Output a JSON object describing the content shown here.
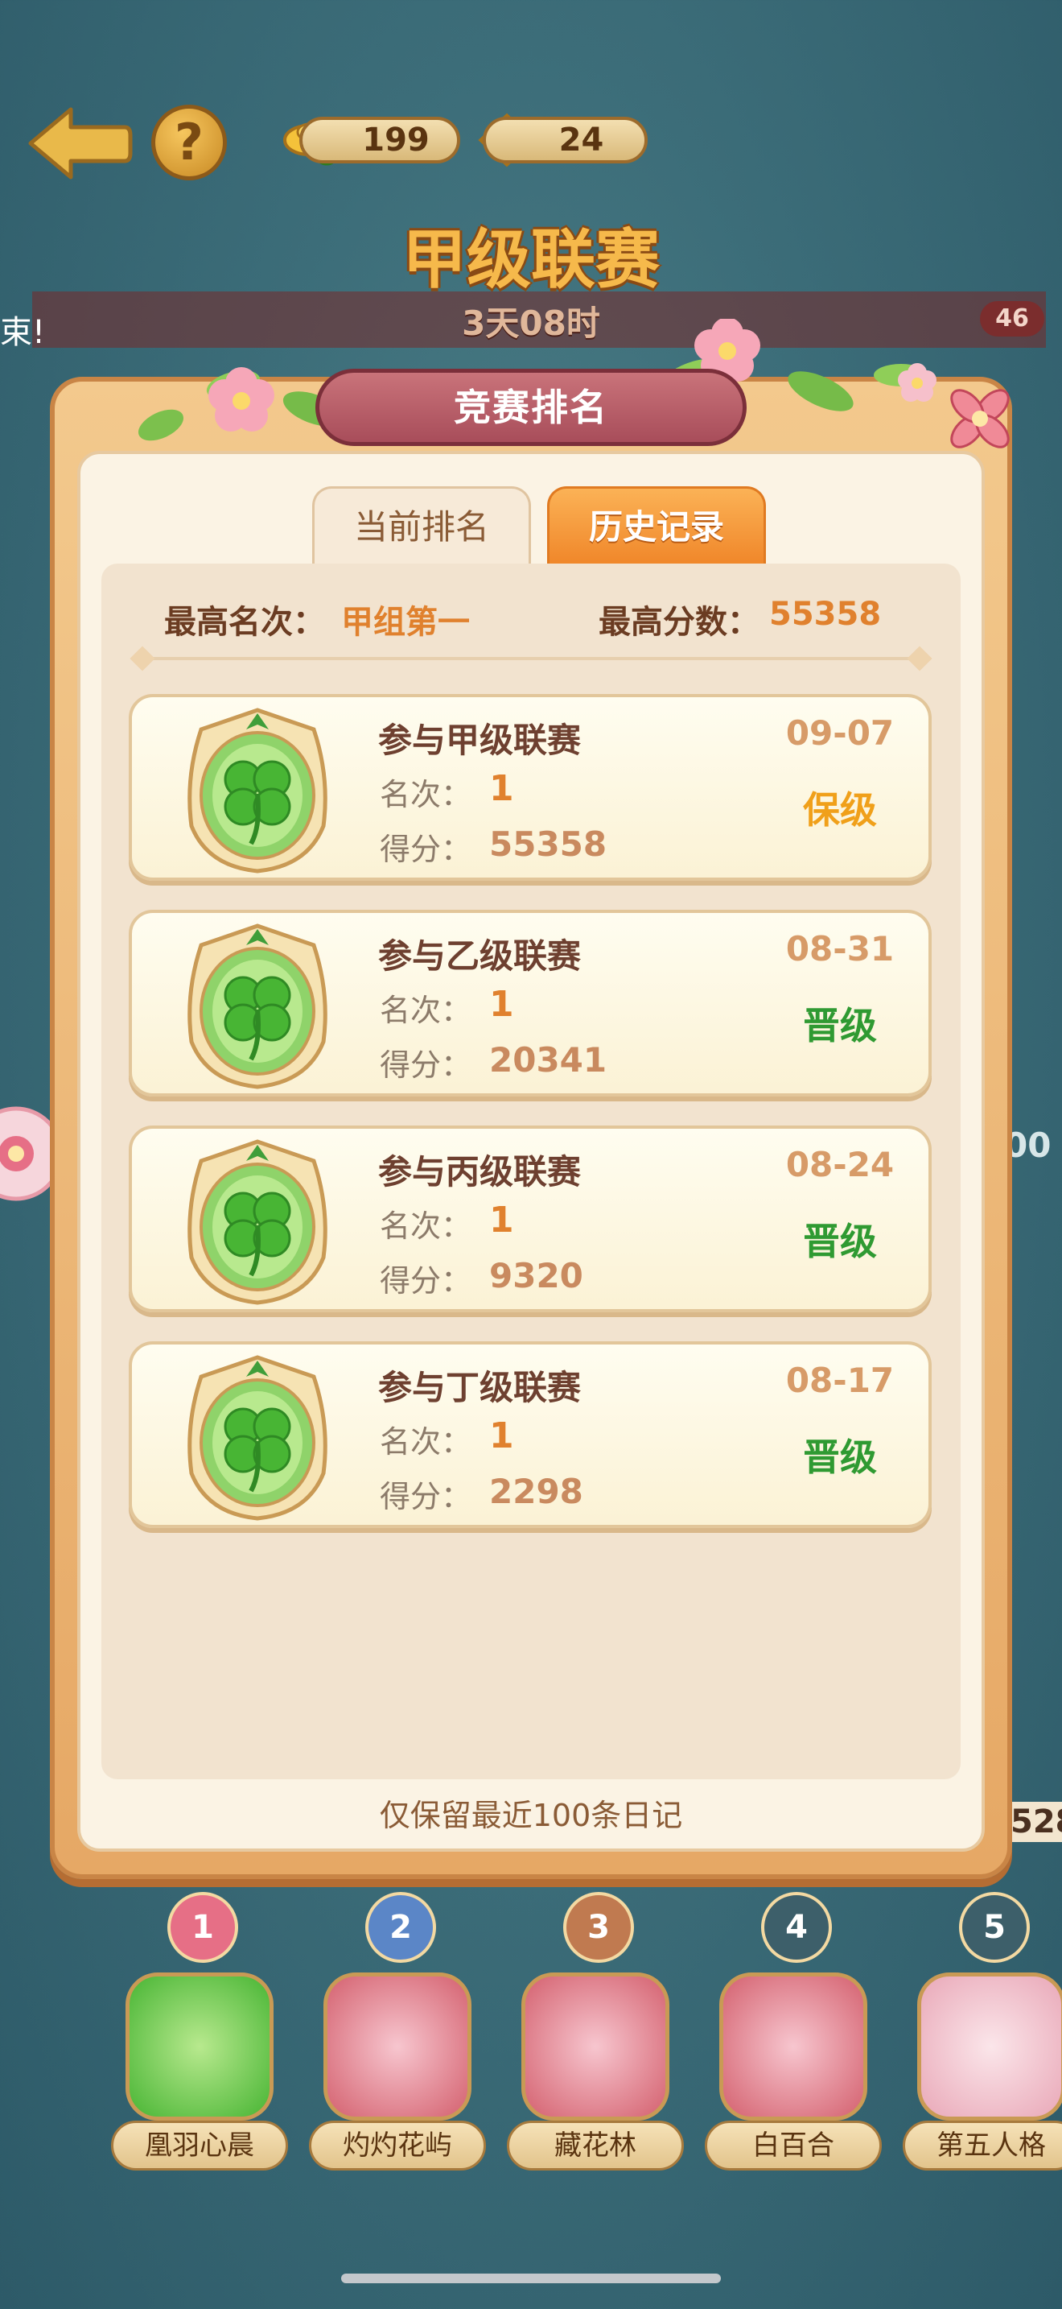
{
  "hud": {
    "currency_gold": "199",
    "currency_gem": "24",
    "league_title": "甲级联赛",
    "timer": "3天08时",
    "edge_text": "束!",
    "badge_count": "46"
  },
  "panel": {
    "title": "竞赛排名",
    "tabs": [
      {
        "label": "当前排名",
        "active": false
      },
      {
        "label": "历史记录",
        "active": true
      }
    ],
    "best_rank_label": "最高名次：",
    "best_rank_value": "甲组第一",
    "best_score_label": "最高分数：",
    "best_score_value": "55358",
    "records": [
      {
        "league": "参与甲级联赛",
        "date": "09-07",
        "rank_label": "名次：",
        "rank": "1",
        "score_label": "得分：",
        "score": "55358",
        "result": "保级",
        "result_color": "#f0a01a"
      },
      {
        "league": "参与乙级联赛",
        "date": "08-31",
        "rank_label": "名次：",
        "rank": "1",
        "score_label": "得分：",
        "score": "20341",
        "result": "晋级",
        "result_color": "#2f9a32"
      },
      {
        "league": "参与丙级联赛",
        "date": "08-24",
        "rank_label": "名次：",
        "rank": "1",
        "score_label": "得分：",
        "score": "9320",
        "result": "晋级",
        "result_color": "#2f9a32"
      },
      {
        "league": "参与丁级联赛",
        "date": "08-17",
        "rank_label": "名次：",
        "rank": "1",
        "score_label": "得分：",
        "score": "2298",
        "result": "晋级",
        "result_color": "#2f9a32"
      }
    ],
    "footer_note": "仅保留最近100条日记"
  },
  "teams": [
    {
      "rank": "1",
      "name": "凰羽心晨",
      "emblem": "clover"
    },
    {
      "rank": "2",
      "name": "灼灼花屿",
      "emblem": "plum-blossom"
    },
    {
      "rank": "3",
      "name": "藏花林",
      "emblem": "plum-blossom"
    },
    {
      "rank": "4",
      "name": "白百合",
      "emblem": "plum-blossom"
    },
    {
      "rank": "5",
      "name": "第五人格",
      "emblem": "lotus"
    }
  ],
  "side_fragments": {
    "right_number_top": "00",
    "right_number_bottom": "528"
  },
  "colors": {
    "accent_orange": "#f0872a",
    "promotion_green": "#2f9a32",
    "retain_orange": "#f0a01a"
  }
}
